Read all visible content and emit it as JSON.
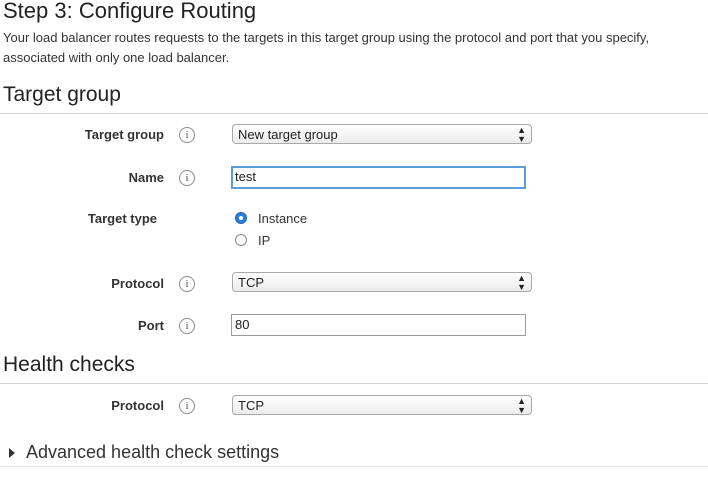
{
  "header": {
    "title": "Step 3: Configure Routing",
    "description": "Your load balancer routes requests to the targets in this target group using the protocol and port that you specify, associated with only one load balancer."
  },
  "target_group": {
    "section_title": "Target group",
    "target_group_label": "Target group",
    "target_group_value": "New target group",
    "name_label": "Name",
    "name_value": "test",
    "target_type_label": "Target type",
    "target_type_options": [
      {
        "label": "Instance",
        "selected": true
      },
      {
        "label": "IP",
        "selected": false
      }
    ],
    "protocol_label": "Protocol",
    "protocol_value": "TCP",
    "port_label": "Port",
    "port_value": "80"
  },
  "health_checks": {
    "section_title": "Health checks",
    "protocol_label": "Protocol",
    "protocol_value": "TCP",
    "advanced_label": "Advanced health check settings"
  },
  "icons": {
    "info": "i",
    "select_arrows": "▲▼"
  },
  "colors": {
    "focus_border": "#5b9dd9",
    "radio_selected": "#2d7ed8"
  }
}
